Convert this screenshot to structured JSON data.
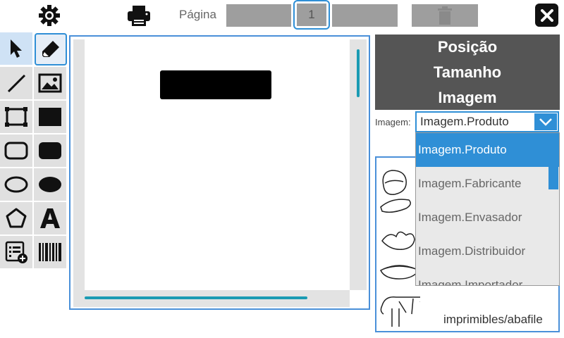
{
  "header": {
    "settings_icon": "gear-icon",
    "print_icon": "printer-icon",
    "page_label": "Página",
    "page_number": "1",
    "delete_icon": "trash-icon",
    "close_icon": "close-icon"
  },
  "toolbox": {
    "tools": [
      {
        "name": "select-tool",
        "icon": "pointer-icon"
      },
      {
        "name": "eraser-tool",
        "icon": "eraser-icon"
      },
      {
        "name": "line-tool",
        "icon": "line-icon"
      },
      {
        "name": "image-tool",
        "icon": "image-icon"
      },
      {
        "name": "rectangle-tool",
        "icon": "rectangle-outline-icon"
      },
      {
        "name": "filled-rectangle-tool",
        "icon": "rectangle-filled-icon"
      },
      {
        "name": "rounded-rectangle-tool",
        "icon": "rounded-rectangle-outline-icon"
      },
      {
        "name": "filled-rounded-rectangle-tool",
        "icon": "rounded-rectangle-filled-icon"
      },
      {
        "name": "ellipse-tool",
        "icon": "ellipse-outline-icon"
      },
      {
        "name": "filled-ellipse-tool",
        "icon": "ellipse-filled-icon"
      },
      {
        "name": "polygon-tool",
        "icon": "pentagon-icon"
      },
      {
        "name": "text-tool",
        "icon": "text-icon"
      },
      {
        "name": "add-field-tool",
        "icon": "list-add-icon"
      },
      {
        "name": "barcode-tool",
        "icon": "barcode-icon"
      }
    ]
  },
  "panel": {
    "headings": [
      "Posição",
      "Tamanho",
      "Imagem"
    ],
    "image_label": "Imagem:",
    "selected_image": "Imagem.Produto",
    "dropdown_options": [
      "Imagem.Produto",
      "Imagem.Fabricante",
      "Imagem.Envasador",
      "Imagem.Distribuidor",
      "Imagem.Importador"
    ],
    "gallery_caption": "imprimibles/abafile"
  },
  "colors": {
    "accent": "#2f8fd6",
    "panel_header": "#555555",
    "scrollbar": "#1a9bb3"
  }
}
